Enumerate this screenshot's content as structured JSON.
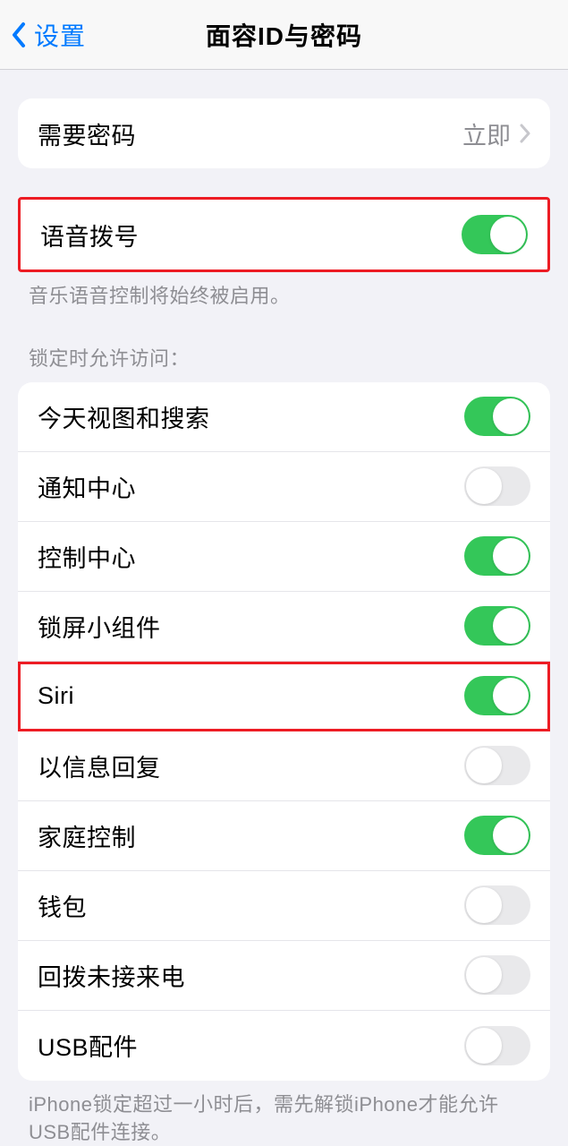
{
  "header": {
    "back_label": "设置",
    "title": "面容ID与密码"
  },
  "require_passcode": {
    "label": "需要密码",
    "value": "立即"
  },
  "voice_dial": {
    "label": "语音拨号",
    "on": true,
    "footer": "音乐语音控制将始终被启用。"
  },
  "allow_access_header": "锁定时允许访问：",
  "allow_access": {
    "items": [
      {
        "label": "今天视图和搜索",
        "on": true,
        "highlight": false
      },
      {
        "label": "通知中心",
        "on": false,
        "highlight": false
      },
      {
        "label": "控制中心",
        "on": true,
        "highlight": false
      },
      {
        "label": "锁屏小组件",
        "on": true,
        "highlight": false
      },
      {
        "label": "Siri",
        "on": true,
        "highlight": true
      },
      {
        "label": "以信息回复",
        "on": false,
        "highlight": false
      },
      {
        "label": "家庭控制",
        "on": true,
        "highlight": false
      },
      {
        "label": "钱包",
        "on": false,
        "highlight": false
      },
      {
        "label": "回拨未接来电",
        "on": false,
        "highlight": false
      },
      {
        "label": "USB配件",
        "on": false,
        "highlight": false
      }
    ]
  },
  "usb_footer": "iPhone锁定超过一小时后，需先解锁iPhone才能允许USB配件连接。"
}
